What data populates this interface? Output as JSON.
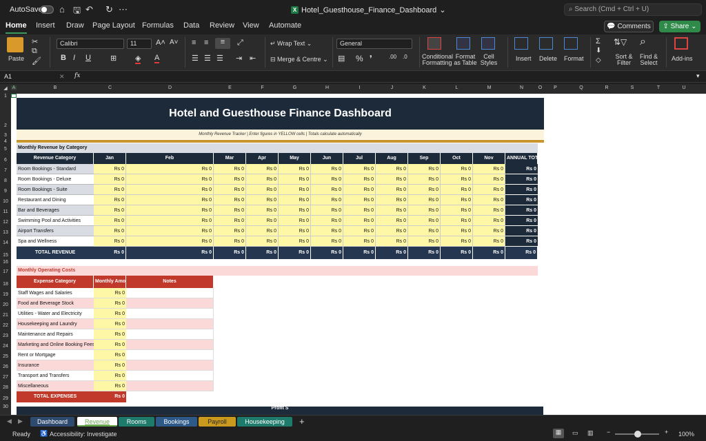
{
  "titlebar": {
    "autosave": "AutoSave",
    "title": "Hotel_Guesthouse_Finance_Dashboard",
    "search": "Search (Cmd + Ctrl + U)"
  },
  "tabs": [
    "Home",
    "Insert",
    "Draw",
    "Page Layout",
    "Formulas",
    "Data",
    "Review",
    "View",
    "Automate"
  ],
  "buttons": {
    "comments": "Comments",
    "share": "Share"
  },
  "ribbon": {
    "paste": "Paste",
    "font_name": "Calibri",
    "font_size": "11",
    "wrap_text": "Wrap Text",
    "merge": "Merge & Centre",
    "number_format": "General",
    "cond_fmt": "Conditional\nFormatting",
    "format_table": "Format\nas Table",
    "cell_styles": "Cell\nStyles",
    "insert": "Insert",
    "delete": "Delete",
    "format": "Format",
    "sort_filter": "Sort &\nFilter",
    "find_select": "Find &\nSelect",
    "addins": "Add-ins"
  },
  "formula_bar": {
    "name_box": "A1",
    "fx": "fx",
    "content": ""
  },
  "columns": [
    "A",
    "B",
    "C",
    "D",
    "E",
    "F",
    "G",
    "H",
    "I",
    "J",
    "K",
    "L",
    "M",
    "N",
    "O",
    "P",
    "Q",
    "R",
    "S",
    "T",
    "U"
  ],
  "rows": [
    "1",
    "2",
    "3",
    "4",
    "5",
    "6",
    "7",
    "8",
    "9",
    "10",
    "11",
    "12",
    "13",
    "14",
    "15",
    "16",
    "17",
    "18",
    "19",
    "20",
    "21",
    "22",
    "23",
    "24",
    "25",
    "26",
    "27",
    "28",
    "29",
    "30"
  ],
  "sheet": {
    "title": "Hotel and Guesthouse Finance Dashboard",
    "subtitle": "Monthly Revenue Tracker  |  Enter figures in YELLOW cells  |  Totals calculate automatically",
    "revenue_section": "Monthly Revenue by Category",
    "revenue_headers": [
      "Revenue Category",
      "Jan",
      "Feb",
      "Mar",
      "Apr",
      "May",
      "Jun",
      "Jul",
      "Aug",
      "Sep",
      "Oct",
      "Nov",
      "ANNUAL TOTAL"
    ],
    "revenue_rows": [
      "Room Bookings - Standard",
      "Room Bookings - Deluxe",
      "Room Bookings - Suite",
      "Restaurant and Dining",
      "Bar and Beverages",
      "Swimming Pool and Activities",
      "Airport Transfers",
      "Spa and Wellness"
    ],
    "cell_value": "Rs 0",
    "total_revenue": "TOTAL REVENUE",
    "costs_section": "Monthly Operating Costs",
    "cost_headers": [
      "Expense Category",
      "Monthly Amount",
      "Notes"
    ],
    "cost_rows": [
      "Staff Wages and Salaries",
      "Food and Beverage Stock",
      "Utilities - Water and Electricity",
      "Housekeeping and Laundry",
      "Maintenance and Repairs",
      "Marketing and Online Booking Fees",
      "Rent or Mortgage",
      "Insurance",
      "Transport and Transfers",
      "Miscellaneous"
    ],
    "total_expenses": "TOTAL EXPENSES",
    "profit_hint": "Profit S"
  },
  "sheet_tabs": [
    {
      "label": "Dashboard",
      "color": "#2e4a6e"
    },
    {
      "label": "Revenue",
      "color": "#6aa84f"
    },
    {
      "label": "Rooms",
      "color": "#1e7a6a"
    },
    {
      "label": "Bookings",
      "color": "#2e5a8a"
    },
    {
      "label": "Payroll",
      "color": "#c99a1e"
    },
    {
      "label": "Housekeeping",
      "color": "#1e7a6a"
    }
  ],
  "status": {
    "ready": "Ready",
    "accessibility": "Accessibility: Investigate",
    "zoom": "100%"
  }
}
